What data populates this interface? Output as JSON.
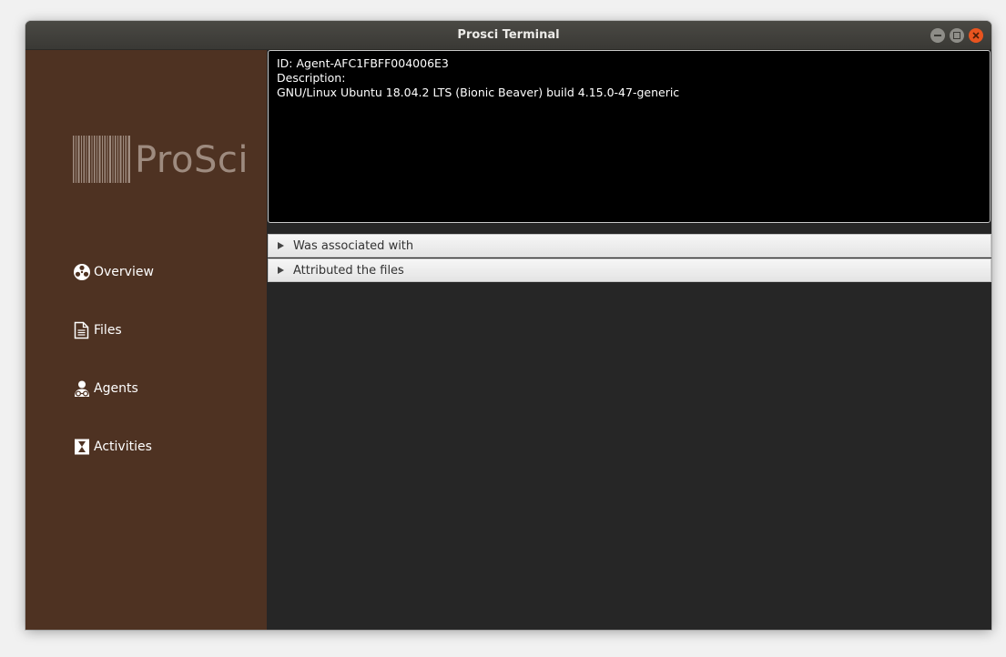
{
  "window": {
    "title": "Prosci Terminal"
  },
  "sidebar": {
    "logo_text": "ProSci",
    "items": [
      {
        "label": "Overview",
        "icon": "overview-icon"
      },
      {
        "label": "Files",
        "icon": "file-icon"
      },
      {
        "label": "Agents",
        "icon": "agents-icon"
      },
      {
        "label": "Activities",
        "icon": "activities-icon"
      }
    ]
  },
  "console": {
    "lines": [
      "ID: Agent-AFC1FBFF004006E3",
      "Description:",
      "GNU/Linux Ubuntu 18.04.2 LTS (Bionic Beaver) build 4.15.0-47-generic"
    ]
  },
  "panes": [
    {
      "label": "Was associated with"
    },
    {
      "label": "Attributed the files"
    }
  ],
  "colors": {
    "sidebar_bg": "#4e3222",
    "main_bg": "#262626",
    "console_bg": "#000000",
    "close_button": "#e9541f"
  }
}
